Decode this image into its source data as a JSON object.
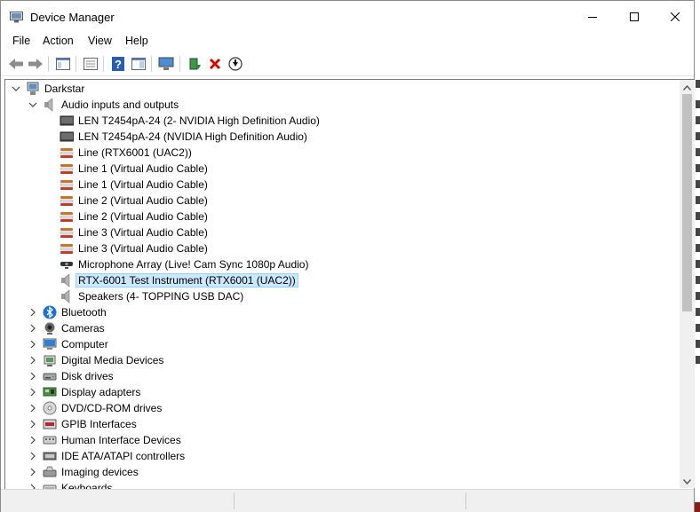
{
  "window": {
    "title": "Device Manager"
  },
  "menu": [
    "File",
    "Action",
    "View",
    "Help"
  ],
  "toolbar": {
    "buttons": [
      {
        "icon": "back-arrow-icon"
      },
      {
        "icon": "forward-arrow-icon"
      },
      {
        "icon": "show-hide-console-tree-icon"
      },
      {
        "icon": "properties-icon"
      },
      {
        "icon": "help-icon"
      },
      {
        "icon": "action-pane-icon"
      },
      {
        "icon": "scan-hardware-changes-icon"
      },
      {
        "icon": "update-driver-icon"
      },
      {
        "icon": "uninstall-device-icon"
      },
      {
        "icon": "download-driver-icon"
      }
    ]
  },
  "tree": {
    "root": "Darkstar",
    "audio_category": "Audio inputs and outputs",
    "audio_devices": [
      {
        "label": "LEN T2454pA-24 (2- NVIDIA High Definition Audio)",
        "icon": "monitor-speaker-icon"
      },
      {
        "label": "LEN T2454pA-24 (NVIDIA High Definition Audio)",
        "icon": "monitor-speaker-icon"
      },
      {
        "label": "Line (RTX6001 (UAC2))",
        "icon": "line-jack-icon"
      },
      {
        "label": "Line 1 (Virtual Audio Cable)",
        "icon": "line-jack-icon"
      },
      {
        "label": "Line 1 (Virtual Audio Cable)",
        "icon": "line-jack-icon"
      },
      {
        "label": "Line 2 (Virtual Audio Cable)",
        "icon": "line-jack-icon"
      },
      {
        "label": "Line 2 (Virtual Audio Cable)",
        "icon": "line-jack-icon"
      },
      {
        "label": "Line 3 (Virtual Audio Cable)",
        "icon": "line-jack-icon"
      },
      {
        "label": "Line 3 (Virtual Audio Cable)",
        "icon": "line-jack-icon"
      },
      {
        "label": "Microphone Array (Live! Cam Sync 1080p Audio)",
        "icon": "webcam-microphone-icon"
      },
      {
        "label": "RTX-6001 Test Instrument (RTX6001 (UAC2))",
        "icon": "speaker-icon",
        "selected": true
      },
      {
        "label": "Speakers (4- TOPPING USB DAC)",
        "icon": "speaker-icon"
      }
    ],
    "categories": [
      {
        "label": "Bluetooth",
        "icon": "bluetooth-icon"
      },
      {
        "label": "Cameras",
        "icon": "camera-icon"
      },
      {
        "label": "Computer",
        "icon": "computer-icon"
      },
      {
        "label": "Digital Media Devices",
        "icon": "digital-media-icon"
      },
      {
        "label": "Disk drives",
        "icon": "disk-drive-icon"
      },
      {
        "label": "Display adapters",
        "icon": "display-adapter-icon"
      },
      {
        "label": "DVD/CD-ROM drives",
        "icon": "dvd-drive-icon"
      },
      {
        "label": "GPIB Interfaces",
        "icon": "gpib-interface-icon"
      },
      {
        "label": "Human Interface Devices",
        "icon": "hid-icon"
      },
      {
        "label": "IDE ATA/ATAPI controllers",
        "icon": "ide-controller-icon"
      },
      {
        "label": "Imaging devices",
        "icon": "imaging-device-icon"
      },
      {
        "label": "Keyboards",
        "icon": "keyboard-icon"
      }
    ]
  },
  "colors": {
    "selection": "#cce8ff",
    "selection_border": "#99d1ff"
  }
}
